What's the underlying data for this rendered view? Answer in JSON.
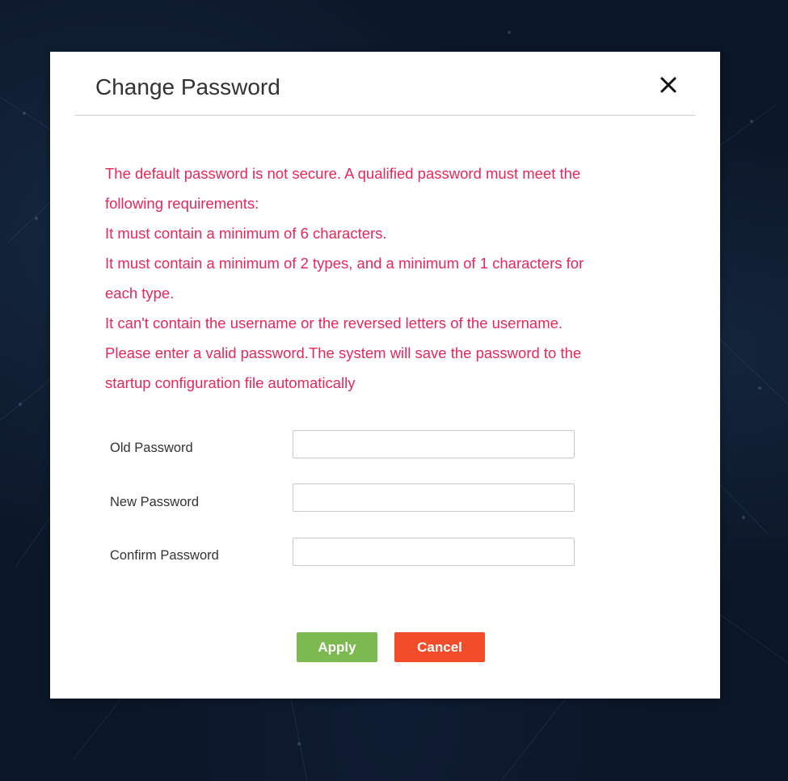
{
  "dialog": {
    "title": "Change Password",
    "notice_lines": [
      "The default password is not secure. A qualified password must meet the",
      "following requirements:",
      "It must contain a minimum of 6 characters.",
      "It must contain a minimum of 2 types, and a minimum of 1 characters for",
      "each type.",
      "It can't contain the username or the reversed letters of the username.",
      "Please enter a valid password.The system will save the password to the",
      "startup configuration file automatically"
    ],
    "fields": {
      "old_password": {
        "label": "Old Password",
        "value": ""
      },
      "new_password": {
        "label": "New Password",
        "value": ""
      },
      "confirm_password": {
        "label": "Confirm Password",
        "value": ""
      }
    },
    "buttons": {
      "apply": "Apply",
      "cancel": "Cancel"
    },
    "close_icon": "close-icon"
  },
  "colors": {
    "notice_text": "#e8275a",
    "apply_button": "#7cb950",
    "cancel_button": "#f24d2b",
    "background": "#0b1627"
  }
}
